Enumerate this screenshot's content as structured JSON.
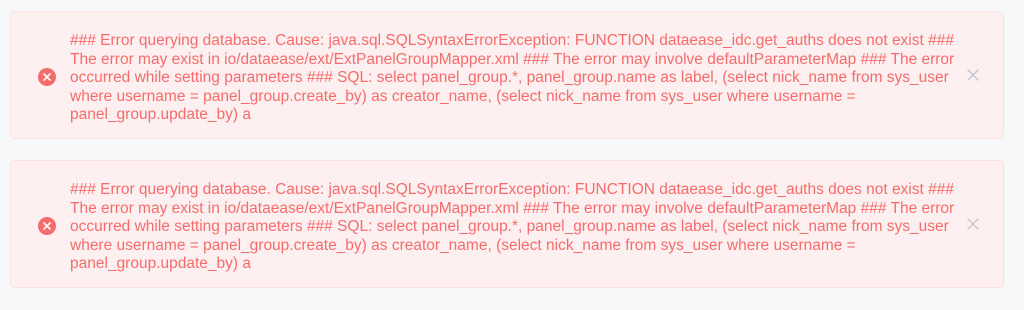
{
  "alerts": [
    {
      "type": "error",
      "icon": "circle-close-icon",
      "close_icon": "close-icon",
      "message": "### Error querying database. Cause: java.sql.SQLSyntaxErrorException: FUNCTION dataease_idc.get_auths does not exist ### The error may exist in io/dataease/ext/ExtPanelGroupMapper.xml ### The error may involve defaultParameterMap ### The error occurred while setting parameters ### SQL: select panel_group.*, panel_group.name as label, (select nick_name from sys_user where username = panel_group.create_by) as creator_name, (select nick_name from sys_user where username = panel_group.update_by) a"
    },
    {
      "type": "error",
      "icon": "circle-close-icon",
      "close_icon": "close-icon",
      "message": "### Error querying database. Cause: java.sql.SQLSyntaxErrorException: FUNCTION dataease_idc.get_auths does not exist ### The error may exist in io/dataease/ext/ExtPanelGroupMapper.xml ### The error may involve defaultParameterMap ### The error occurred while setting parameters ### SQL: select panel_group.*, panel_group.name as label, (select nick_name from sys_user where username = panel_group.create_by) as creator_name, (select nick_name from sys_user where username = panel_group.update_by) a"
    }
  ],
  "colors": {
    "background": "#f7f8fa",
    "alert_background": "#fef0f0",
    "alert_border": "#fbe3e3",
    "error_text": "#f56c6c",
    "close_icon": "#c0c4cc"
  }
}
